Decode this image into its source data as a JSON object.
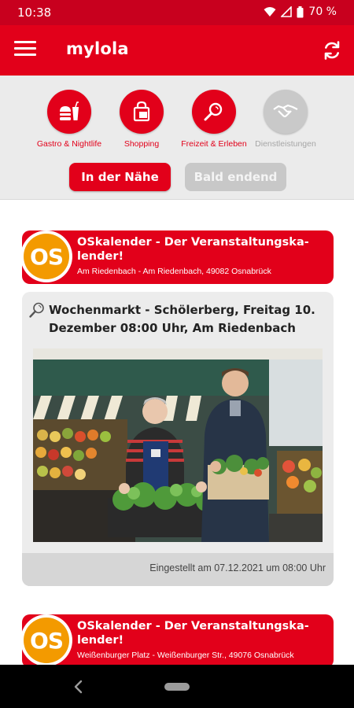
{
  "status_bar": {
    "time": "10:38",
    "battery": "70 %"
  },
  "app_bar": {
    "title": "mylola",
    "menu_icon": "hamburger-menu-icon",
    "refresh_icon": "refresh-icon"
  },
  "categories": [
    {
      "label": "Gastro & Nightlife",
      "icon": "burger-drink-icon",
      "enabled": true
    },
    {
      "label": "Shopping",
      "icon": "shopping-bag-icon",
      "enabled": true
    },
    {
      "label": "Freizeit & Erleben",
      "icon": "magnifier-icon",
      "enabled": true
    },
    {
      "label": "Dienstleistungen",
      "icon": "handshake-icon",
      "enabled": false
    }
  ],
  "filters": {
    "nearby": "In der Nähe",
    "ending_soon": "Bald endend"
  },
  "feed": [
    {
      "source": {
        "name": "OSkalender - Der Veranstaltungska-lender!",
        "address": "Am Riedenbach - Am Riedenbach, 49082 Osnabrück",
        "logo_text": "OS"
      },
      "event": {
        "title": "Wochenmarkt - Schölerberg, Freitag 10. Dezember 08:00 Uhr, Am Riedenbach",
        "posted": "Eingestellt am 07.12.2021 um 08:00 Uhr"
      }
    },
    {
      "source": {
        "name": "OSkalender - Der Veranstaltungska-lender!",
        "address": "Weißenburger Platz - Weißenburger Str., 49076 Osnabrück",
        "logo_text": "OS"
      }
    }
  ],
  "colors": {
    "primary": "#e2001a",
    "status_bar": "#c8001e",
    "logo_orange": "#f39a00",
    "disabled": "#c9c9c9"
  }
}
